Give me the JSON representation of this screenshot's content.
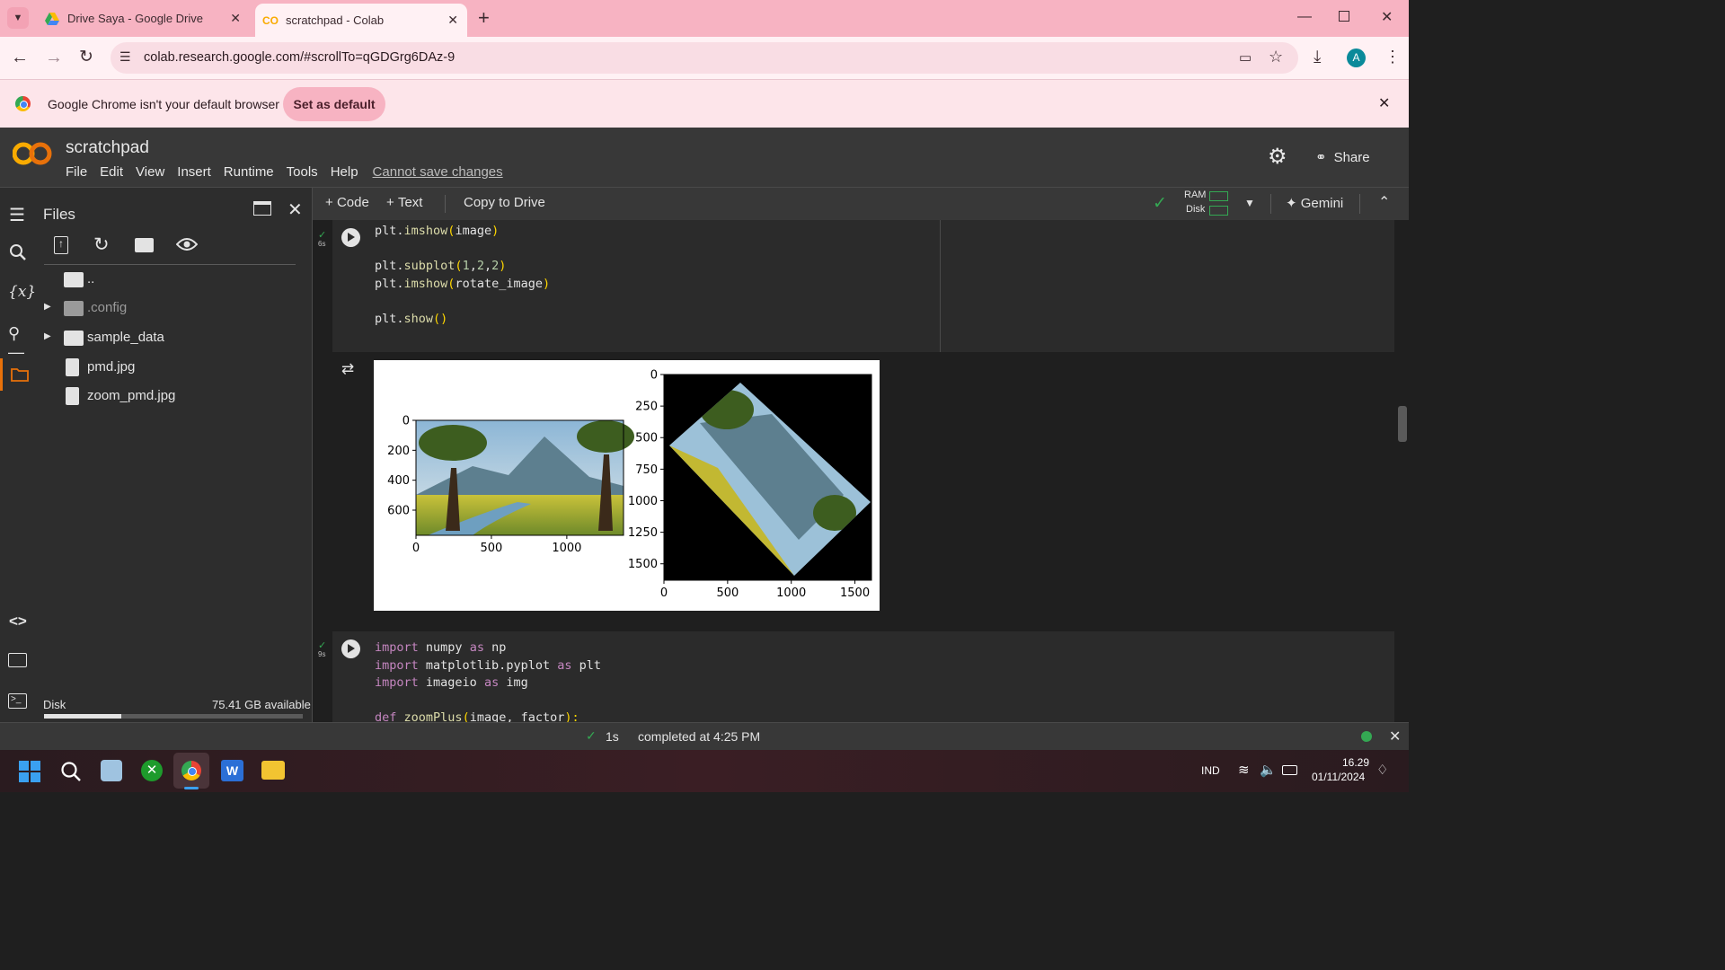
{
  "browser": {
    "tabs": [
      {
        "title": "Drive Saya - Google Drive",
        "active": false
      },
      {
        "title": "scratchpad - Colab",
        "active": true
      }
    ],
    "url": "colab.research.google.com/#scrollTo=qGDGrg6DAz-9",
    "profile_initial": "A",
    "infobar_text": "Google Chrome isn't your default browser",
    "infobar_button": "Set as default"
  },
  "colab": {
    "notebook_title": "scratchpad",
    "menu": [
      "File",
      "Edit",
      "View",
      "Insert",
      "Runtime",
      "Tools",
      "Help"
    ],
    "save_status": "Cannot save changes",
    "share_label": "Share",
    "toolbar": {
      "code_label": "Code",
      "text_label": "Text",
      "copy_to_drive": "Copy to Drive",
      "ram_label": "RAM",
      "disk_label": "Disk",
      "gemini_label": "Gemini"
    }
  },
  "files_panel": {
    "title": "Files",
    "items": [
      {
        "name": "..",
        "type": "folder-open"
      },
      {
        "name": ".config",
        "type": "folder"
      },
      {
        "name": "sample_data",
        "type": "folder"
      },
      {
        "name": "pmd.jpg",
        "type": "file"
      },
      {
        "name": "zoom_pmd.jpg",
        "type": "file"
      }
    ],
    "disk_label": "Disk",
    "disk_available": "75.41 GB available",
    "disk_used_fraction": 0.3
  },
  "cells": [
    {
      "exec_time": "6s",
      "lines": [
        [
          {
            "t": "plt.",
            "c": ""
          },
          {
            "t": "imshow",
            "c": "fn"
          },
          {
            "t": "(",
            "c": "paren"
          },
          {
            "t": "image",
            "c": ""
          },
          {
            "t": ")",
            "c": "paren"
          }
        ],
        [],
        [
          {
            "t": "plt.",
            "c": ""
          },
          {
            "t": "subplot",
            "c": "fn"
          },
          {
            "t": "(",
            "c": "paren"
          },
          {
            "t": "1",
            "c": "num"
          },
          {
            "t": ",",
            "c": ""
          },
          {
            "t": "2",
            "c": "num"
          },
          {
            "t": ",",
            "c": ""
          },
          {
            "t": "2",
            "c": "num"
          },
          {
            "t": ")",
            "c": "paren"
          }
        ],
        [
          {
            "t": "plt.",
            "c": ""
          },
          {
            "t": "imshow",
            "c": "fn"
          },
          {
            "t": "(",
            "c": "paren"
          },
          {
            "t": "rotate_image",
            "c": ""
          },
          {
            "t": ")",
            "c": "paren"
          }
        ],
        [],
        [
          {
            "t": "plt.",
            "c": ""
          },
          {
            "t": "show",
            "c": "fn"
          },
          {
            "t": "()",
            "c": "paren"
          }
        ]
      ]
    },
    {
      "exec_time": "9s",
      "lines": [
        [
          {
            "t": "import",
            "c": "kw"
          },
          {
            "t": " numpy ",
            "c": ""
          },
          {
            "t": "as",
            "c": "kw"
          },
          {
            "t": " np",
            "c": ""
          }
        ],
        [
          {
            "t": "import",
            "c": "kw"
          },
          {
            "t": " matplotlib.pyplot ",
            "c": ""
          },
          {
            "t": "as",
            "c": "kw"
          },
          {
            "t": " plt",
            "c": ""
          }
        ],
        [
          {
            "t": "import",
            "c": "kw"
          },
          {
            "t": " imageio ",
            "c": ""
          },
          {
            "t": "as",
            "c": "kw"
          },
          {
            "t": " img",
            "c": ""
          }
        ],
        [],
        [
          {
            "t": "def",
            "c": "kw"
          },
          {
            "t": " ",
            "c": ""
          },
          {
            "t": "zoomPlus",
            "c": "fn"
          },
          {
            "t": "(",
            "c": "paren"
          },
          {
            "t": "image, factor",
            "c": ""
          },
          {
            "t": "):",
            "c": "paren"
          }
        ]
      ]
    }
  ],
  "chart_data": [
    {
      "type": "image",
      "x_ticks": [
        "0",
        "500",
        "1000"
      ],
      "y_ticks": [
        "0",
        "200",
        "400",
        "600"
      ],
      "xlim": [
        0,
        1376
      ],
      "ylim": [
        768,
        0
      ]
    },
    {
      "type": "image",
      "x_ticks": [
        "0",
        "500",
        "1000",
        "1500"
      ],
      "y_ticks": [
        "0",
        "250",
        "500",
        "750",
        "1000",
        "1250",
        "1500"
      ],
      "xlim": [
        0,
        1630
      ],
      "ylim": [
        1630,
        0
      ]
    }
  ],
  "status_bar": {
    "duration": "1s",
    "completed_text": "completed at 4:25 PM"
  },
  "taskbar": {
    "language": "IND",
    "time": "16.29",
    "date": "01/11/2024"
  },
  "colors": {
    "tabstrip": "#f7b3c2",
    "colab_orange": "#f9ab00",
    "accent_green": "#34a853"
  }
}
